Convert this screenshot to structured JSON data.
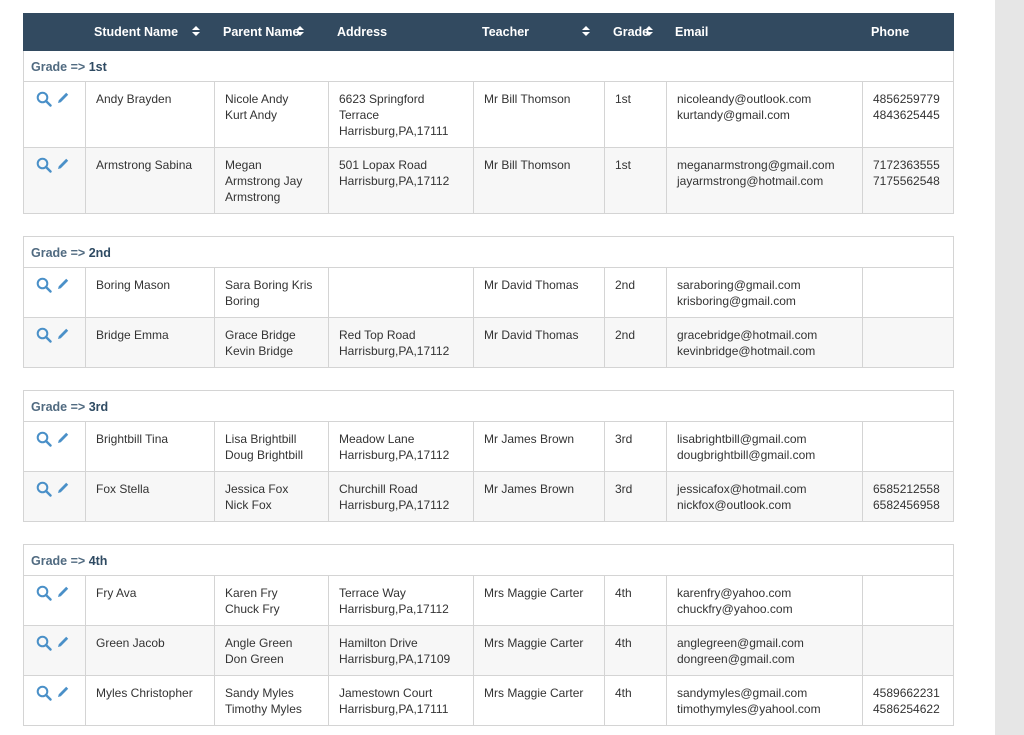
{
  "header": {
    "columns": [
      "",
      "Student Name",
      "Parent Name",
      "Address",
      "Teacher",
      "Grade",
      "Email",
      "Phone"
    ]
  },
  "colors": {
    "header_bg": "#324a60",
    "accent": "#4a90c8",
    "border": "#d4d4d4"
  },
  "icons": {
    "view": "magnifier-icon",
    "edit": "pencil-icon",
    "sort": "sort-arrows-icon"
  },
  "grade_prefix": "Grade =>",
  "groups": [
    {
      "grade": "1st",
      "rows": [
        {
          "student": "Andy Brayden",
          "parents": [
            "Nicole Andy",
            "Kurt Andy"
          ],
          "address": [
            "6623 Springford",
            "Terrace",
            "Harrisburg,PA,17111"
          ],
          "teacher": "Mr Bill Thomson",
          "grade": "1st",
          "emails": [
            "nicoleandy@outlook.com",
            "kurtandy@gmail.com"
          ],
          "phones": [
            "4856259779",
            "4843625445"
          ]
        },
        {
          "student": "Armstrong Sabina",
          "parents": [
            "Megan",
            "Armstrong Jay",
            "Armstrong"
          ],
          "address": [
            "501 Lopax Road",
            "Harrisburg,PA,17112"
          ],
          "teacher": "Mr Bill Thomson",
          "grade": "1st",
          "emails": [
            "meganarmstrong@gmail.com",
            "jayarmstrong@hotmail.com"
          ],
          "phones": [
            "7172363555",
            "7175562548"
          ]
        }
      ]
    },
    {
      "grade": "2nd",
      "rows": [
        {
          "student": "Boring Mason",
          "parents": [
            "Sara Boring Kris",
            "Boring"
          ],
          "address": [],
          "teacher": "Mr David Thomas",
          "grade": "2nd",
          "emails": [
            "saraboring@gmail.com",
            "krisboring@gmail.com"
          ],
          "phones": []
        },
        {
          "student": "Bridge Emma",
          "parents": [
            "Grace Bridge",
            "Kevin Bridge"
          ],
          "address": [
            "Red Top Road",
            "Harrisburg,PA,17112"
          ],
          "teacher": "Mr David Thomas",
          "grade": "2nd",
          "emails": [
            "gracebridge@hotmail.com",
            "kevinbridge@hotmail.com"
          ],
          "phones": []
        }
      ]
    },
    {
      "grade": "3rd",
      "rows": [
        {
          "student": "Brightbill Tina",
          "parents": [
            "Lisa Brightbill",
            "Doug Brightbill"
          ],
          "address": [
            "Meadow Lane",
            "Harrisburg,PA,17112"
          ],
          "teacher": "Mr James Brown",
          "grade": "3rd",
          "emails": [
            "lisabrightbill@gmail.com",
            "dougbrightbill@gmail.com"
          ],
          "phones": []
        },
        {
          "student": "Fox Stella",
          "parents": [
            "Jessica Fox",
            "Nick Fox"
          ],
          "address": [
            "Churchill Road",
            "Harrisburg,PA,17112"
          ],
          "teacher": "Mr James Brown",
          "grade": "3rd",
          "emails": [
            "jessicafox@hotmail.com",
            "nickfox@outlook.com"
          ],
          "phones": [
            "6585212558",
            "6582456958"
          ]
        }
      ]
    },
    {
      "grade": "4th",
      "rows": [
        {
          "student": "Fry Ava",
          "parents": [
            "Karen Fry",
            "Chuck Fry"
          ],
          "address": [
            "Terrace Way",
            "Harrisburg,Pa,17112"
          ],
          "teacher": "Mrs Maggie Carter",
          "grade": "4th",
          "emails": [
            "karenfry@yahoo.com",
            "chuckfry@yahoo.com"
          ],
          "phones": []
        },
        {
          "student": "Green Jacob",
          "parents": [
            "Angle Green",
            "Don Green"
          ],
          "address": [
            "Hamilton Drive",
            "Harrisburg,PA,17109"
          ],
          "teacher": "Mrs Maggie Carter",
          "grade": "4th",
          "emails": [
            "anglegreen@gmail.com",
            "dongreen@gmail.com"
          ],
          "phones": []
        },
        {
          "student": "Myles Christopher",
          "parents": [
            "Sandy Myles",
            "Timothy Myles"
          ],
          "address": [
            "Jamestown Court",
            "Harrisburg,PA,17111"
          ],
          "teacher": "Mrs Maggie Carter",
          "grade": "4th",
          "emails": [
            "sandymyles@gmail.com",
            "timothymyles@yahool.com"
          ],
          "phones": [
            "4589662231",
            "4586254622"
          ]
        }
      ]
    }
  ]
}
